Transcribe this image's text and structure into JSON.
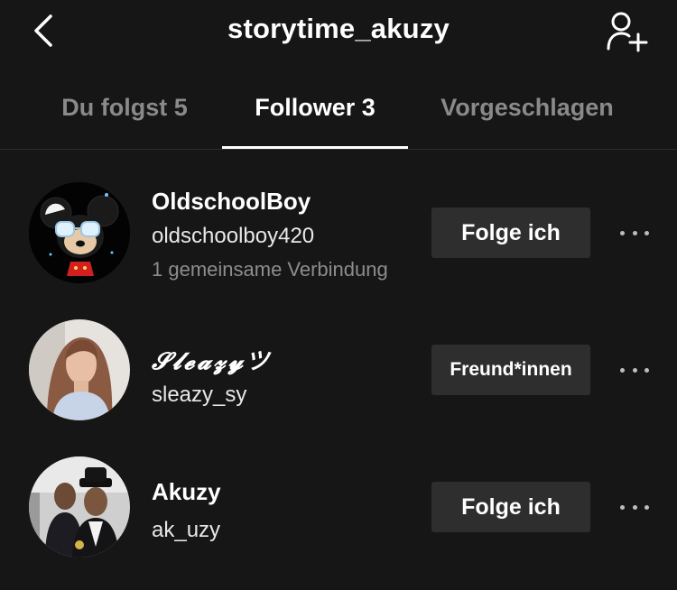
{
  "header": {
    "title": "storytime_akuzy",
    "back_icon": "chevron-left-icon",
    "add_user_icon": "add-user-icon"
  },
  "tabs": [
    {
      "label": "Du folgst 5",
      "active": false
    },
    {
      "label": "Follower 3",
      "active": true
    },
    {
      "label": "Vorgeschlagen",
      "active": false
    }
  ],
  "followers": [
    {
      "name": "OldschoolBoy",
      "username": "oldschoolboy420",
      "mutual": "1 gemeinsame Verbindung",
      "button": "Folge ich",
      "avatar": "mickey-avatar"
    },
    {
      "name": "𝓢𝓵𝓮𝓪𝔃𝔂ツ",
      "username": "sleazy_sy",
      "mutual": "",
      "button": "Freund*innen",
      "avatar": "woman-avatar"
    },
    {
      "name": "Akuzy",
      "username": "ak_uzy",
      "mutual": "",
      "button": "Folge ich",
      "avatar": "men-photo-avatar"
    }
  ],
  "colors": {
    "background": "#161616",
    "button": "#2e2e2e",
    "muted": "#8a8a8a"
  }
}
